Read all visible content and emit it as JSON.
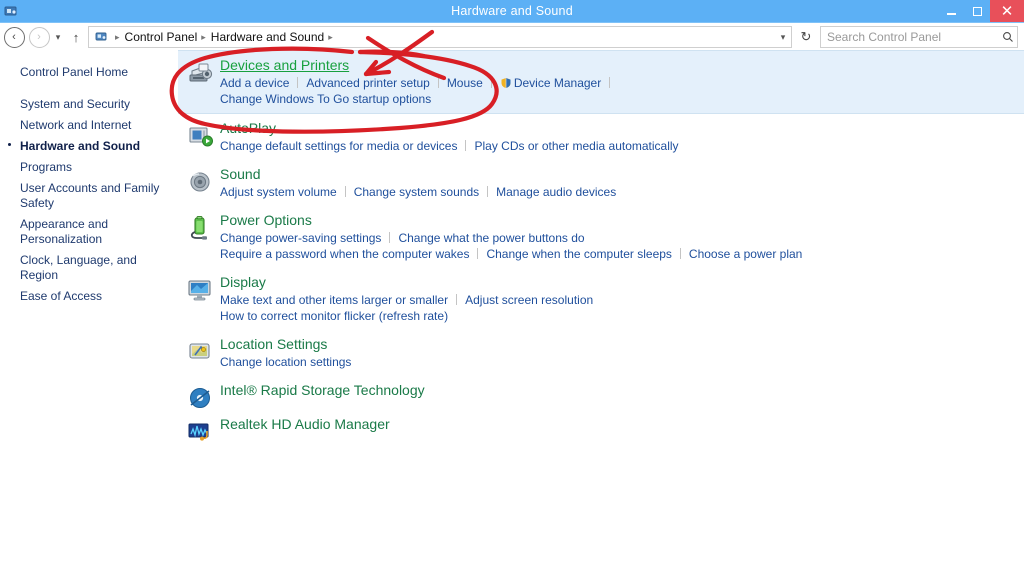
{
  "window": {
    "title": "Hardware and Sound",
    "icon": "control-panel-icon",
    "buttons": {
      "minimize": "–",
      "maximize": "□",
      "close": "✕"
    }
  },
  "toolbar": {
    "back": "‹",
    "forward": "›",
    "history_dropdown": "▾",
    "up": "↑",
    "refresh": "↻",
    "address_dropdown": "▾",
    "breadcrumbs": [
      "Control Panel",
      "Hardware and Sound"
    ],
    "breadcrumb_separator": "▸",
    "search": {
      "placeholder": "Search Control Panel",
      "icon": "search-icon"
    }
  },
  "sidebar": {
    "home": "Control Panel Home",
    "items": [
      {
        "label": "System and Security",
        "current": false
      },
      {
        "label": "Network and Internet",
        "current": false
      },
      {
        "label": "Hardware and Sound",
        "current": true
      },
      {
        "label": "Programs",
        "current": false
      },
      {
        "label": "User Accounts and Family Safety",
        "current": false
      },
      {
        "label": "Appearance and Personalization",
        "current": false
      },
      {
        "label": "Clock, Language, and Region",
        "current": false
      },
      {
        "label": "Ease of Access",
        "current": false
      }
    ]
  },
  "main": {
    "sections": [
      {
        "title": "Devices and Printers",
        "icon": "printer-icon",
        "highlighted": true,
        "title_hover": true,
        "rows": [
          [
            {
              "text": "Add a device"
            },
            {
              "text": "Advanced printer setup"
            },
            {
              "text": "Mouse"
            },
            {
              "text": "Device Manager",
              "shield": true
            }
          ],
          [
            {
              "text": "Change Windows To Go startup options"
            }
          ]
        ]
      },
      {
        "title": "AutoPlay",
        "icon": "autoplay-icon",
        "highlighted": false,
        "title_hover": false,
        "rows": [
          [
            {
              "text": "Change default settings for media or devices"
            },
            {
              "text": "Play CDs or other media automatically"
            }
          ]
        ]
      },
      {
        "title": "Sound",
        "icon": "sound-icon",
        "highlighted": false,
        "title_hover": false,
        "rows": [
          [
            {
              "text": "Adjust system volume"
            },
            {
              "text": "Change system sounds"
            },
            {
              "text": "Manage audio devices"
            }
          ]
        ]
      },
      {
        "title": "Power Options",
        "icon": "power-icon",
        "highlighted": false,
        "title_hover": false,
        "rows": [
          [
            {
              "text": "Change power-saving settings"
            },
            {
              "text": "Change what the power buttons do"
            }
          ],
          [
            {
              "text": "Require a password when the computer wakes"
            },
            {
              "text": "Change when the computer sleeps"
            },
            {
              "text": "Choose a power plan"
            }
          ]
        ]
      },
      {
        "title": "Display",
        "icon": "display-icon",
        "highlighted": false,
        "title_hover": false,
        "rows": [
          [
            {
              "text": "Make text and other items larger or smaller"
            },
            {
              "text": "Adjust screen resolution"
            }
          ],
          [
            {
              "text": "How to correct monitor flicker (refresh rate)"
            }
          ]
        ]
      },
      {
        "title": "Location Settings",
        "icon": "location-icon",
        "highlighted": false,
        "title_hover": false,
        "rows": [
          [
            {
              "text": "Change location settings"
            }
          ]
        ]
      },
      {
        "title": "Intel® Rapid Storage Technology",
        "icon": "intel-icon",
        "highlighted": false,
        "title_hover": false,
        "rows": []
      },
      {
        "title": "Realtek HD Audio Manager",
        "icon": "realtek-icon",
        "highlighted": false,
        "title_hover": false,
        "rows": []
      }
    ]
  },
  "annotation": {
    "color": "#d81f25",
    "shapes": [
      "ellipse-around-devices-and-printers",
      "arrow-pointing-to-devices-and-printers"
    ]
  },
  "colors": {
    "titlebar": "#5cb0f5",
    "close_button": "#e8505a",
    "highlight_row": "#e4f0fb",
    "section_title": "#1a7a48",
    "section_title_hover": "#18a03f",
    "link": "#1f4f9c",
    "sidebar_text": "#1f3a6e"
  }
}
